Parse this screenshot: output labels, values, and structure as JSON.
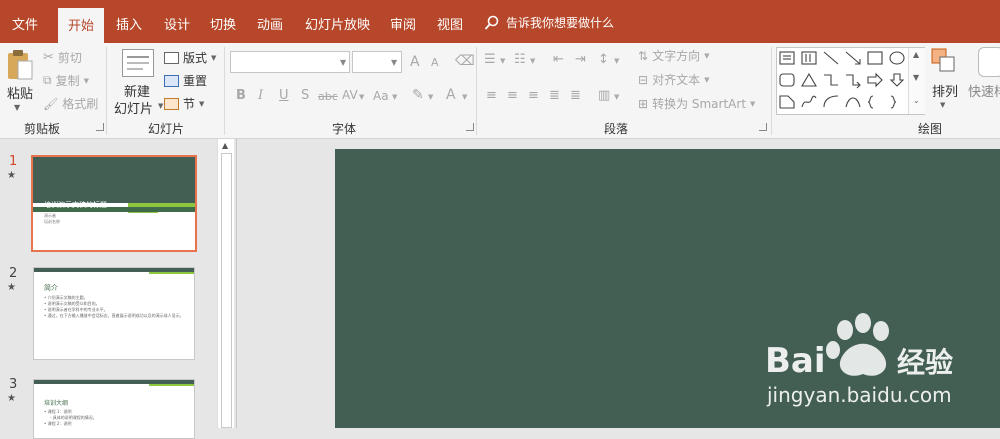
{
  "tabs": [
    {
      "label": "文件"
    },
    {
      "label": "开始"
    },
    {
      "label": "插入"
    },
    {
      "label": "设计"
    },
    {
      "label": "切换"
    },
    {
      "label": "动画"
    },
    {
      "label": "幻灯片放映"
    },
    {
      "label": "审阅"
    },
    {
      "label": "视图"
    }
  ],
  "tell_me": "告诉我你想要做什么",
  "clipboard": {
    "paste": "粘贴",
    "cut": "剪切",
    "copy": "复制",
    "format_painter": "格式刷",
    "group": "剪贴板"
  },
  "slides_group": {
    "new_slide_line1": "新建",
    "new_slide_line2": "幻灯片",
    "layout": "版式",
    "reset": "重置",
    "section": "节",
    "group": "幻灯片"
  },
  "font_group": {
    "bold": "B",
    "italic": "I",
    "underline": "U",
    "shadow": "S",
    "strike": "abc",
    "spacing": "AV",
    "case": "Aa",
    "grow": "A",
    "shrink": "A",
    "color_a": "A",
    "group": "字体"
  },
  "paragraph_group": {
    "text_direction": "文字方向",
    "align_text": "对齐文本",
    "smartart": "转换为 SmartArt",
    "group": "段落"
  },
  "drawing_group": {
    "arrange": "排列",
    "quick_styles": "快速样",
    "group": "绘图"
  },
  "slides": [
    {
      "number": "1",
      "title": "培训演示文稿的标题",
      "sub1": "演示者",
      "sub2": "培训名称"
    },
    {
      "number": "2",
      "title": "简介",
      "bullets": [
        "介绍演示文稿的主题。",
        "说明演示文稿的受众和目的。",
        "说明演示者在学科中的专业水平。",
        "通过，在下方输入播放中会话标志，直着展示说明成功以及的演示成人显示。"
      ]
    },
    {
      "number": "3",
      "title": "培训大纲",
      "bullets": [
        "课程 1：说明",
        "具体的说明课程的情况。",
        "课程 2：说明"
      ]
    }
  ],
  "watermark": {
    "brand_left": "Bai",
    "brand_right": "经验",
    "url": "jingyan.baidu.com"
  },
  "colors": {
    "accent": "#b7472a",
    "slide_bg": "#435e52",
    "selected_border": "#e8734f",
    "title_green": "#3f6b4a",
    "bar_green": "#8dc63f"
  }
}
